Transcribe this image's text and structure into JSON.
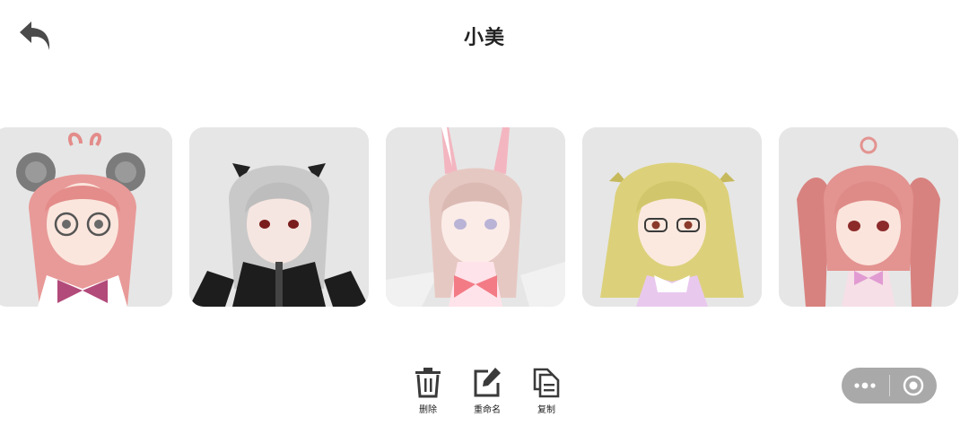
{
  "header": {
    "title": "小美",
    "back_icon": "back-arrow-icon"
  },
  "gallery": {
    "items": [
      {
        "hair": "#e89a98",
        "accent": "#7b7b7b",
        "outfit": "#ffffff",
        "bow": "#b24a7a",
        "extra": "bear-ears-glasses"
      },
      {
        "hair": "#c9c9c9",
        "accent": "#222222",
        "outfit": "#1d1d1d",
        "bow": "#1d1d1d",
        "extra": "cat-ears-wings"
      },
      {
        "hair": "#e6c8c2",
        "accent": "#f3b6c0",
        "outfit": "#ffe3ea",
        "bow": "#f37b86",
        "extra": "bunny-ears"
      },
      {
        "hair": "#dcd17a",
        "accent": "#c6b95c",
        "outfit": "#e9c8ee",
        "bow": "#d98fd3",
        "extra": "glasses"
      },
      {
        "hair": "#e39390",
        "accent": "#c66e6c",
        "outfit": "#f6dfe6",
        "bow": "#e19bd2",
        "extra": "twin-tails"
      }
    ]
  },
  "toolbar": {
    "delete_label": "删除",
    "rename_label": "重命名",
    "copy_label": "复制"
  },
  "capsule": {
    "more_icon": "more-dots-icon",
    "close_icon": "target-circle-icon",
    "bg_color": "#a9a9a9"
  }
}
